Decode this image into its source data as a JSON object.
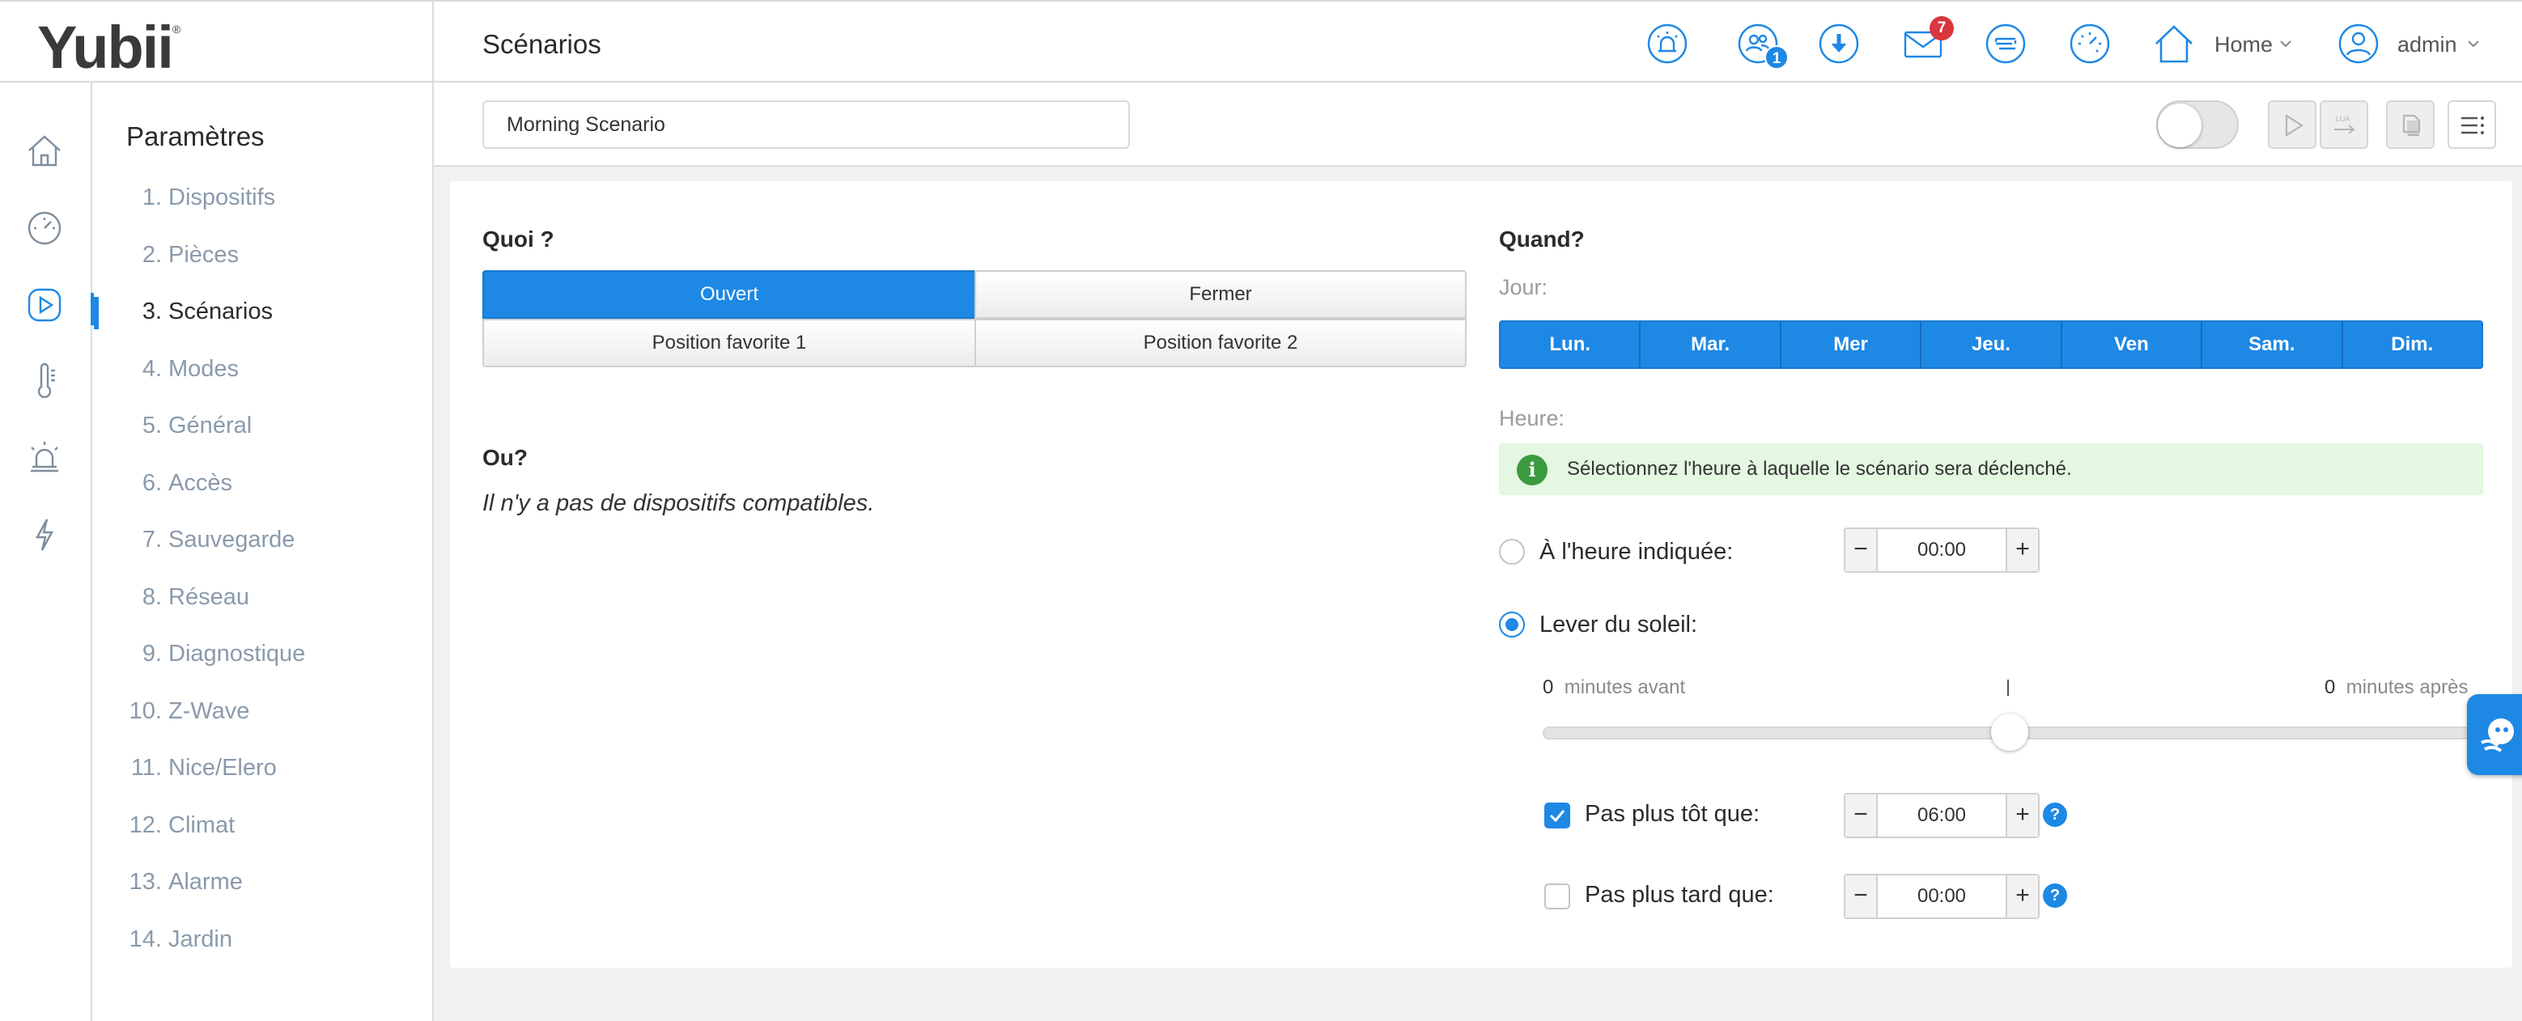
{
  "header": {
    "logo": "Yubii",
    "logo_mark": "®",
    "page_title": "Scénarios",
    "icons": [
      "alarm-icon",
      "users-icon",
      "download-icon",
      "mail-icon",
      "messages-icon",
      "dashboard-clock-icon",
      "home-icon",
      "user-icon"
    ],
    "users_badge": "1",
    "mail_badge": "7",
    "home_label": "Home",
    "user_label": "admin"
  },
  "rail": {
    "icons": [
      "home-icon",
      "gauge-icon",
      "play-icon",
      "thermometer-icon",
      "siren-icon",
      "bolt-icon"
    ],
    "active": "play-icon"
  },
  "menu": {
    "title": "Paramètres",
    "items": [
      {
        "num": "1.",
        "label": "Dispositifs"
      },
      {
        "num": "2.",
        "label": "Pièces"
      },
      {
        "num": "3.",
        "label": "Scénarios"
      },
      {
        "num": "4.",
        "label": "Modes"
      },
      {
        "num": "5.",
        "label": "Général"
      },
      {
        "num": "6.",
        "label": "Accès"
      },
      {
        "num": "7.",
        "label": "Sauvegarde"
      },
      {
        "num": "8.",
        "label": "Réseau"
      },
      {
        "num": "9.",
        "label": "Diagnostique"
      },
      {
        "num": "10.",
        "label": "Z-Wave"
      },
      {
        "num": "11.",
        "label": "Nice/Elero"
      },
      {
        "num": "12.",
        "label": "Climat"
      },
      {
        "num": "13.",
        "label": "Alarme"
      },
      {
        "num": "14.",
        "label": "Jardin"
      }
    ],
    "active_index": 2
  },
  "toolbar": {
    "scenario_name": "Morning Scenario",
    "enabled": false,
    "buttons": [
      "play-icon",
      "lua-convert-icon",
      "copy-icon",
      "menu-icon"
    ],
    "lua_label": "LUA"
  },
  "quoi": {
    "label": "Quoi ?",
    "options": [
      "Ouvert",
      "Fermer",
      "Position favorite 1",
      "Position favorite 2"
    ],
    "selected": "Ouvert"
  },
  "ou": {
    "label": "Ou?",
    "empty_text": "Il n'y a pas de dispositifs compatibles."
  },
  "quand": {
    "label": "Quand?",
    "jour_label": "Jour:",
    "days": [
      "Lun.",
      "Mar.",
      "Mer",
      "Jeu.",
      "Ven",
      "Sam.",
      "Dim."
    ],
    "heure_label": "Heure:",
    "info": "Sélectionnez l'heure à laquelle le scénario sera déclenché.",
    "at_time_label": "À l'heure indiquée:",
    "at_time_value": "00:00",
    "sunrise_label": "Lever du soleil:",
    "selected_option": "sunrise",
    "slider": {
      "before_value": "0",
      "before_label": "minutes avant",
      "after_value": "0",
      "after_label": "minutes après",
      "center_mark": "I",
      "offset_minutes": 0
    },
    "not_earlier": {
      "label": "Pas plus tôt que:",
      "checked": true,
      "value": "06:00"
    },
    "not_later": {
      "label": "Pas plus tard que:",
      "checked": false,
      "value": "00:00"
    },
    "help": "?",
    "minus": "−",
    "plus": "+"
  },
  "colors": {
    "accent": "#1e88e5",
    "badge_red": "#d9363e",
    "info_bg": "#e3f7e1",
    "info_icon": "#3c9a3f"
  }
}
